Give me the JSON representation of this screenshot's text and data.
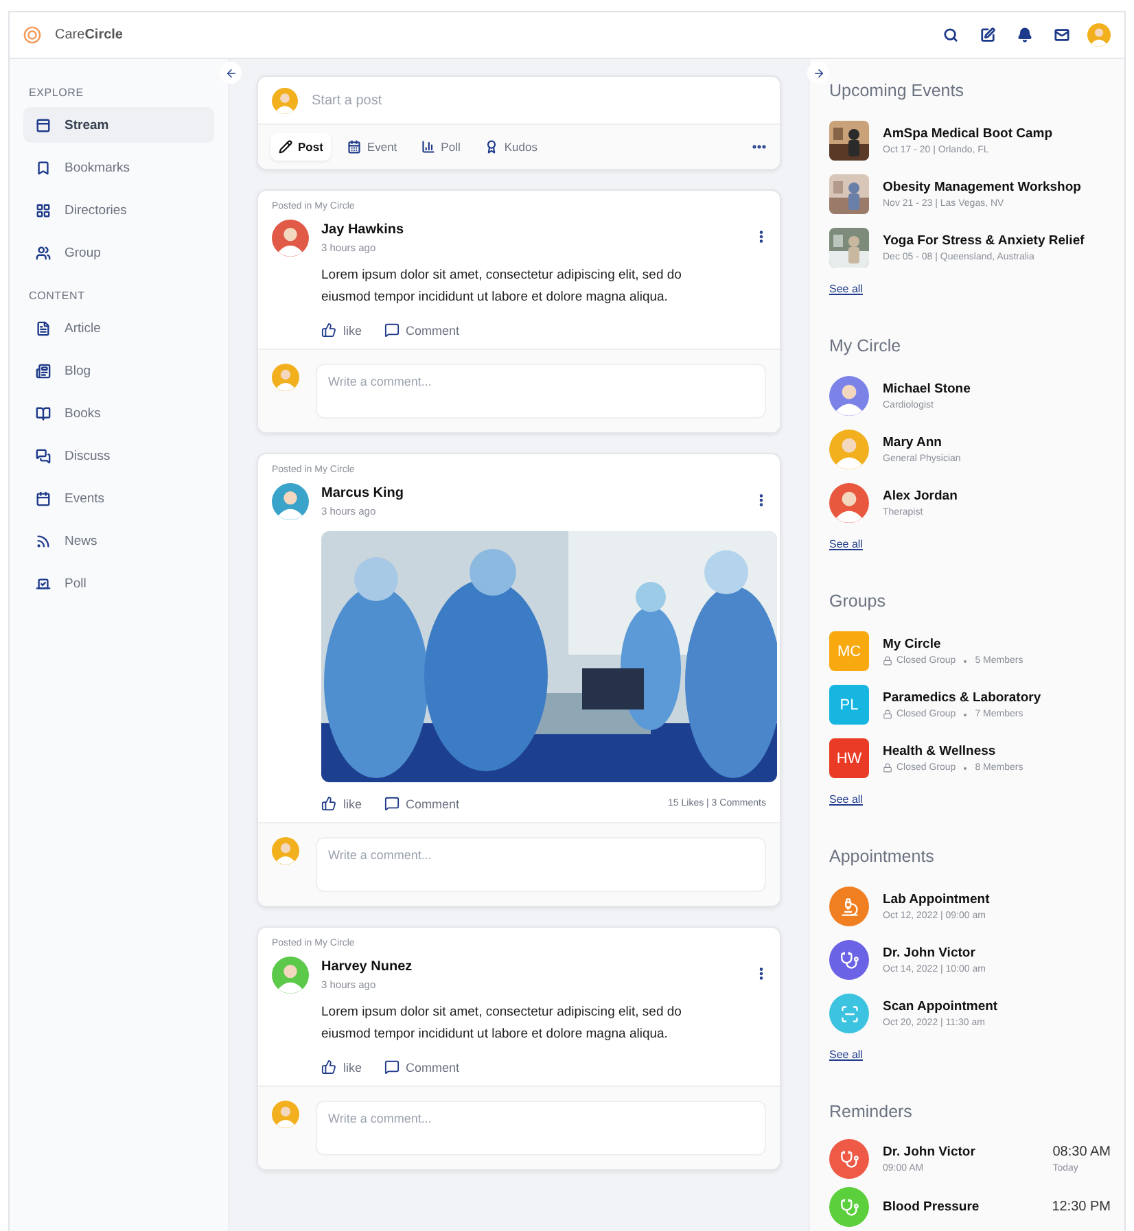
{
  "header": {
    "logo": "Care**Circle**"
  },
  "sidebar": {
    "sections": [
      {
        "title": "EXPLORE",
        "items": [
          {
            "label": "Stream",
            "selected": true
          },
          {
            "label": "Bookmarks",
            "selected": false
          },
          {
            "label": "Directories",
            "selected": false
          },
          {
            "label": "Group",
            "selected": false
          }
        ]
      },
      {
        "title": "CONTENT",
        "items": [
          {
            "label": "Article",
            "selected": false
          },
          {
            "label": "Blog",
            "selected": false
          },
          {
            "label": "Books",
            "selected": false
          },
          {
            "label": "Discuss",
            "selected": false
          },
          {
            "label": "Events",
            "selected": false
          },
          {
            "label": "News",
            "selected": false
          },
          {
            "label": "Poll",
            "selected": false
          }
        ]
      }
    ]
  },
  "composer": {
    "placeholder": "Start a post",
    "actions": [
      {
        "label": "Post",
        "selected": true
      },
      {
        "label": "Event",
        "selected": false
      },
      {
        "label": "Poll",
        "selected": false
      },
      {
        "label": "Kudos",
        "selected": false
      }
    ]
  },
  "posts": [
    {
      "posted_in": "Posted in My Circle",
      "author": "Jay Hawkins",
      "color": "#e05a47",
      "time": "3 hours ago",
      "text": "Lorem ipsum dolor sit amet, consectetur adipiscing elit, sed do eiusmod tempor incididunt ut labore et dolore magna aliqua.",
      "like": "like",
      "comment": "Comment",
      "comment_placeholder": "Write a comment..."
    },
    {
      "posted_in": "Posted in My Circle",
      "author": "Marcus King",
      "color": "#3aa3c9",
      "time": "3 hours ago",
      "like": "like",
      "comment": "Comment",
      "stats": "15 Likes | 3 Comments",
      "comment_placeholder": "Write a comment..."
    },
    {
      "posted_in": "Posted in My Circle",
      "author": "Harvey Nunez",
      "color": "#5cc94a",
      "time": "3 hours ago",
      "text": "Lorem ipsum dolor sit amet, consectetur adipiscing elit, sed do eiusmod tempor incididunt ut labore et dolore magna aliqua.",
      "like": "like",
      "comment": "Comment",
      "comment_placeholder": "Write a comment..."
    }
  ],
  "right": {
    "events": {
      "title": "Upcoming Events",
      "items": [
        {
          "title": "AmSpa Medical Boot Camp",
          "meta": "Oct 17 - 20 | Orlando, FL"
        },
        {
          "title": "Obesity Management Workshop",
          "meta": "Nov 21 - 23 | Las Vegas, NV"
        },
        {
          "title": "Yoga For Stress & Anxiety Relief",
          "meta": "Dec 05 - 08 | Queensland, Australia"
        }
      ],
      "see_all": "See all"
    },
    "circle": {
      "title": "My Circle",
      "items": [
        {
          "name": "Michael Stone",
          "role": "Cardiologist",
          "color": "#7c83e8"
        },
        {
          "name": "Mary Ann",
          "role": "General Physician",
          "color": "#f2b01e"
        },
        {
          "name": "Alex Jordan",
          "role": "Therapist",
          "color": "#e8583f"
        }
      ],
      "see_all": "See all"
    },
    "groups": {
      "title": "Groups",
      "items": [
        {
          "initials": "MC",
          "name": "My Circle",
          "type": "Closed Group",
          "members": "5 Members",
          "color": "#f7a90f"
        },
        {
          "initials": "PL",
          "name": "Paramedics & Laboratory",
          "type": "Closed Group",
          "members": "7 Members",
          "color": "#17b6e0"
        },
        {
          "initials": "HW",
          "name": "Health & Wellness",
          "type": "Closed Group",
          "members": "8 Members",
          "color": "#ea3b26"
        }
      ],
      "see_all": "See all"
    },
    "appointments": {
      "title": "Appointments",
      "items": [
        {
          "title": "Lab Appointment",
          "meta": "Oct 12, 2022 | 09:00 am",
          "color": "#f07f22"
        },
        {
          "title": "Dr. John Victor",
          "meta": "Oct 14, 2022 | 10:00 am",
          "color": "#6b63e6"
        },
        {
          "title": "Scan Appointment",
          "meta": "Oct 20, 2022 | 11:30 am",
          "color": "#3cc3e0"
        }
      ],
      "see_all": "See all"
    },
    "reminders": {
      "title": "Reminders",
      "items": [
        {
          "title": "Dr. John Victor",
          "meta": "09:00 AM",
          "time": "08:30 AM",
          "day": "Today",
          "color": "#ee5a45"
        },
        {
          "title": "Blood Pressure",
          "time": "12:30 PM",
          "color": "#5ccf3c"
        }
      ]
    }
  }
}
